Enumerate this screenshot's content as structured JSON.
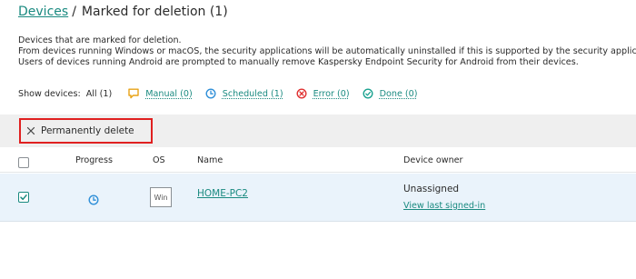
{
  "breadcrumb": {
    "root": "Devices",
    "separator": "/",
    "current": "Marked for deletion (1)"
  },
  "description": [
    "Devices that are marked for deletion.",
    "From devices running Windows or macOS, the security applications will be automatically uninstalled if this is supported by the security application.",
    "Users of devices running Android are prompted to manually remove Kaspersky Endpoint Security for Android from their devices."
  ],
  "filters": {
    "label": "Show devices:",
    "all": "All (1)",
    "items": [
      {
        "name": "manual",
        "label": "Manual (0)",
        "icon": "comment-icon",
        "color": "#e8a317"
      },
      {
        "name": "scheduled",
        "label": "Scheduled (1)",
        "icon": "clock-icon",
        "color": "#2f8fd8"
      },
      {
        "name": "error",
        "label": "Error (0)",
        "icon": "error-icon",
        "color": "#e03030"
      },
      {
        "name": "done",
        "label": "Done (0)",
        "icon": "check-circle-icon",
        "color": "#1aa28f"
      }
    ]
  },
  "toolbar": {
    "permanently_delete": "Permanently delete",
    "highlight_color": "#e02020"
  },
  "table": {
    "columns": {
      "progress": "Progress",
      "os": "OS",
      "name": "Name",
      "owner": "Device owner"
    },
    "rows": [
      {
        "selected": true,
        "progress_icon": "clock-icon",
        "os": "Win",
        "name": "HOME-PC2",
        "owner": "Unassigned",
        "owner_link": "View last signed-in"
      }
    ]
  },
  "colors": {
    "link": "#1a8a80",
    "toolbar_bg": "#efefef",
    "selected_row_bg": "#eaf3fb"
  }
}
